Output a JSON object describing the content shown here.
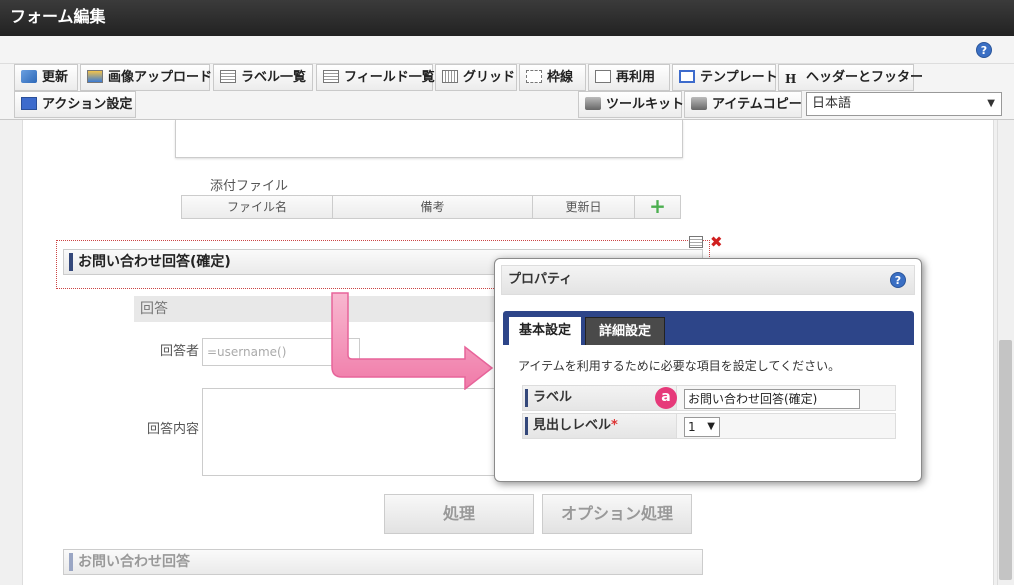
{
  "window": {
    "title": "フォーム編集"
  },
  "help": {
    "symbol": "?"
  },
  "toolbar": {
    "row1": [
      {
        "label": "更新",
        "icon": "refresh-icon"
      },
      {
        "label": "画像アップロード",
        "icon": "image-upload-icon"
      },
      {
        "label": "ラベル一覧",
        "icon": "label-list-icon"
      },
      {
        "label": "フィールド一覧",
        "icon": "field-list-icon"
      },
      {
        "label": "グリッド",
        "icon": "grid-icon"
      },
      {
        "label": "枠線",
        "icon": "border-icon"
      },
      {
        "label": "再利用",
        "icon": "reuse-icon"
      },
      {
        "label": "テンプレート",
        "icon": "template-icon"
      },
      {
        "label": "ヘッダーとフッター",
        "icon": "header-footer-icon"
      }
    ],
    "row2": [
      {
        "label": "アクション設定",
        "icon": "action-settings-icon"
      },
      {
        "label": "ツールキット",
        "icon": "toolkit-icon"
      },
      {
        "label": "アイテムコピー",
        "icon": "item-copy-icon"
      }
    ],
    "language": {
      "selected": "日本語",
      "arrow": "▼"
    }
  },
  "form": {
    "attachment_label": "添付ファイル",
    "attachment_columns": [
      "ファイル名",
      "備考",
      "更新日"
    ],
    "attachment_add": "+",
    "section_title": "お問い合わせ回答(確定)",
    "sub_heading": "回答",
    "respondent_label": "回答者",
    "respondent_value": "=username()",
    "content_label": "回答内容",
    "process_button": "処理",
    "option_button": "オプション処理",
    "next_section_title": "お問い合わせ回答",
    "delete_symbol": "✖"
  },
  "dialog": {
    "title": "プロパティ",
    "help": "?",
    "tabs": [
      "基本設定",
      "詳細設定"
    ],
    "description": "アイテムを利用するために必要な項目を設定してください。",
    "rows": [
      {
        "label": "ラベル",
        "value": "お問い合わせ回答(確定)"
      },
      {
        "label": "見出しレベル",
        "required": "*",
        "value": "1",
        "arrow": "▼"
      }
    ],
    "badge": "a"
  }
}
